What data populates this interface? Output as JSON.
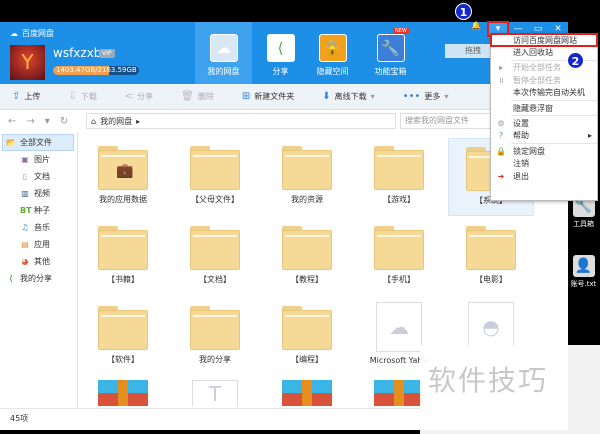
{
  "app": {
    "logo": "百度网盘",
    "username": "wsfxzxb",
    "vip": "VIP",
    "quota_text": "1403.47GB/2163.59GB",
    "quota_fraction": 0.65,
    "drag_hint": "拖拽"
  },
  "nav_tabs": [
    {
      "label": "我的网盘",
      "icon": "cloud"
    },
    {
      "label": "分享",
      "icon": "share"
    },
    {
      "label": "隐藏空间",
      "icon": "lock"
    },
    {
      "label": "功能宝箱",
      "icon": "wrench",
      "badge": "NEW"
    }
  ],
  "toolbar": [
    "上传",
    "下载",
    "分享",
    "删除",
    "新建文件夹",
    "离线下载",
    "更多"
  ],
  "address": {
    "path": "我的网盘",
    "search_placeholder": "搜索我的网盘文件"
  },
  "sidebar": [
    {
      "label": "全部文件",
      "icon": "folder"
    },
    {
      "label": "图片",
      "icon": "image"
    },
    {
      "label": "文档",
      "icon": "doc"
    },
    {
      "label": "视频",
      "icon": "video"
    },
    {
      "label": "种子",
      "icon": "BT"
    },
    {
      "label": "音乐",
      "icon": "music"
    },
    {
      "label": "应用",
      "icon": "app"
    },
    {
      "label": "其他",
      "icon": "other"
    },
    {
      "label": "我的分享",
      "icon": "share"
    }
  ],
  "files": [
    {
      "name": "我的应用数据",
      "type": "folder"
    },
    {
      "name": "【父母文件】",
      "type": "folder"
    },
    {
      "name": "我的资源",
      "type": "folder"
    },
    {
      "name": "【游戏】",
      "type": "folder"
    },
    {
      "name": "【系统】",
      "type": "folder"
    },
    {
      "name": "【书籍】",
      "type": "folder"
    },
    {
      "name": "【文档】",
      "type": "folder"
    },
    {
      "name": "【教程】",
      "type": "folder"
    },
    {
      "name": "【手机】",
      "type": "folder"
    },
    {
      "name": "【电影】",
      "type": "folder"
    },
    {
      "name": "【软件】",
      "type": "folder"
    },
    {
      "name": "我的分享",
      "type": "folder"
    },
    {
      "name": "【编程】",
      "type": "folder"
    },
    {
      "name": "Microsoft YaHe",
      "type": "cloudfile"
    },
    {
      "name": "",
      "type": "file"
    },
    {
      "name": "",
      "type": "zip"
    },
    {
      "name": "",
      "type": "textfile"
    },
    {
      "name": "",
      "type": "zip"
    },
    {
      "name": "",
      "type": "zip"
    }
  ],
  "status": "45项",
  "menu": [
    {
      "label": "访问百度网盘网站",
      "highlight": true
    },
    {
      "label": "进入回收站"
    },
    {
      "sep": true
    },
    {
      "label": "开始全部任务",
      "disabled": true,
      "icon": "▸"
    },
    {
      "label": "暂停全部任务",
      "disabled": true,
      "icon": "॥"
    },
    {
      "label": "本次传输完自动关机"
    },
    {
      "sep": true
    },
    {
      "label": "隐藏悬浮窗"
    },
    {
      "sep": true
    },
    {
      "label": "设置",
      "icon": "⚙"
    },
    {
      "label": "帮助",
      "icon": "?",
      "submenu": true
    },
    {
      "sep": true
    },
    {
      "label": "锁定网盘",
      "icon": "🔒"
    },
    {
      "label": "注销"
    },
    {
      "label": "退出",
      "icon": "➜"
    }
  ],
  "annotations": [
    "1",
    "2"
  ],
  "desktop": [
    {
      "label": "工具箱"
    },
    {
      "label": "账号.txt"
    }
  ],
  "watermark": "软件技巧"
}
